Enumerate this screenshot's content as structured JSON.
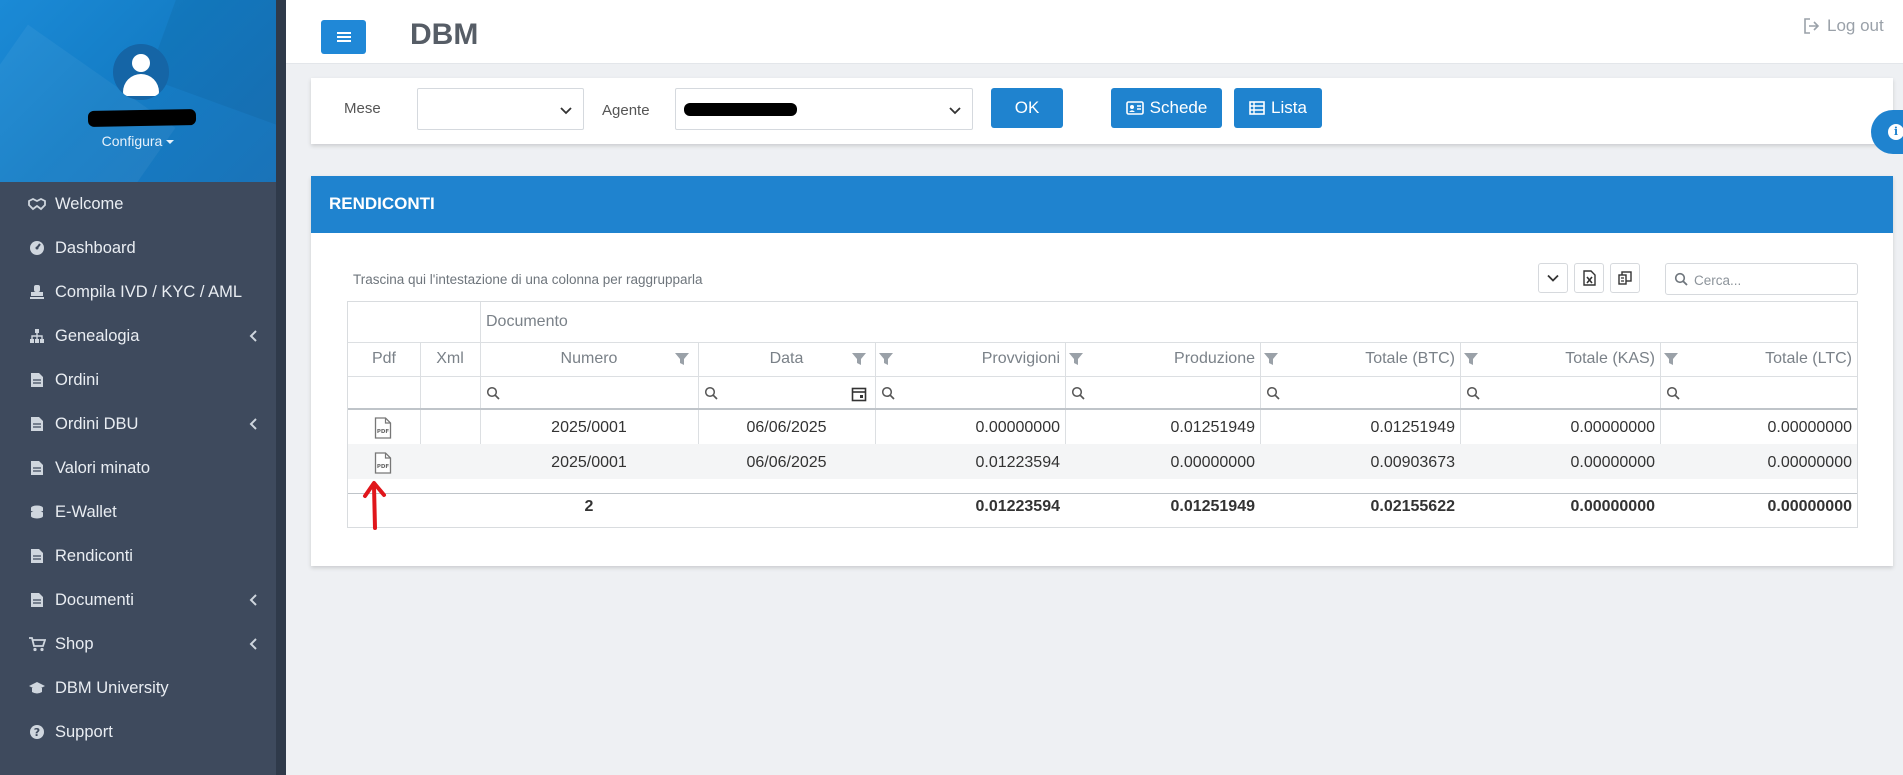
{
  "app": {
    "title": "DBM",
    "logout_label": "Log out"
  },
  "sidebar": {
    "configura_label": "Configura",
    "items": [
      {
        "label": "Welcome",
        "icon": "handshake-icon",
        "has_submenu": false
      },
      {
        "label": "Dashboard",
        "icon": "dashboard-gauge-icon",
        "has_submenu": false
      },
      {
        "label": "Compila IVD / KYC / AML",
        "icon": "stamp-icon",
        "has_submenu": false
      },
      {
        "label": "Genealogia",
        "icon": "sitemap-icon",
        "has_submenu": true
      },
      {
        "label": "Ordini",
        "icon": "document-icon",
        "has_submenu": false
      },
      {
        "label": "Ordini DBU",
        "icon": "document-icon",
        "has_submenu": true
      },
      {
        "label": "Valori minato",
        "icon": "document-icon",
        "has_submenu": false
      },
      {
        "label": "E-Wallet",
        "icon": "coins-icon",
        "has_submenu": false
      },
      {
        "label": "Rendiconti",
        "icon": "document-icon",
        "has_submenu": false
      },
      {
        "label": "Documenti",
        "icon": "document-icon",
        "has_submenu": true
      },
      {
        "label": "Shop",
        "icon": "cart-icon",
        "has_submenu": true
      },
      {
        "label": "DBM University",
        "icon": "graduation-cap-icon",
        "has_submenu": false
      },
      {
        "label": "Support",
        "icon": "question-circle-icon",
        "has_submenu": false
      }
    ]
  },
  "filters": {
    "mese_label": "Mese",
    "mese_value": "",
    "agente_label": "Agente",
    "ok_label": "OK",
    "schede_label": "Schede",
    "lista_label": "Lista"
  },
  "panel": {
    "title": "RENDICONTI",
    "group_hint": "Trascina qui l'intestazione di una colonna per raggrupparla",
    "search_placeholder": "Cerca..."
  },
  "grid": {
    "band_header": "Documento",
    "columns": {
      "pdf": "Pdf",
      "xml": "Xml",
      "numero": "Numero",
      "data": "Data",
      "provvigioni": "Provvigioni",
      "produzione": "Produzione",
      "totale_btc": "Totale (BTC)",
      "totale_kas": "Totale (KAS)",
      "totale_ltc": "Totale (LTC)"
    },
    "rows": [
      {
        "pdf_icon": "pdf-file-icon",
        "numero": "2025/0001",
        "data": "06/06/2025",
        "provvigioni": "0.00000000",
        "produzione": "0.01251949",
        "totale_btc": "0.01251949",
        "totale_kas": "0.00000000",
        "totale_ltc": "0.00000000"
      },
      {
        "pdf_icon": "pdf-file-icon",
        "numero": "2025/0001",
        "data": "06/06/2025",
        "provvigioni": "0.01223594",
        "produzione": "0.00000000",
        "totale_btc": "0.00903673",
        "totale_kas": "0.00000000",
        "totale_ltc": "0.00000000"
      }
    ],
    "summary": {
      "count": "2",
      "provvigioni": "0.01223594",
      "produzione": "0.01251949",
      "totale_btc": "0.02155622",
      "totale_kas": "0.00000000",
      "totale_ltc": "0.00000000"
    }
  },
  "colors": {
    "accent": "#1f83cf",
    "sidebar_bg": "#3e4a5d",
    "annotation_arrow": "#e0161b"
  }
}
